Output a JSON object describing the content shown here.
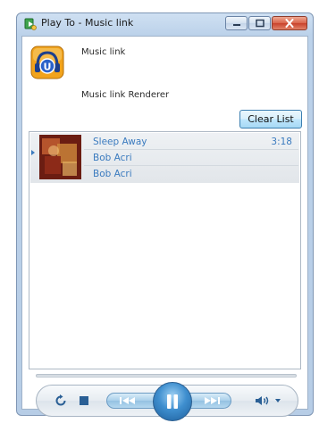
{
  "window": {
    "title": "Play To - Music link",
    "minimize_label": "minimize",
    "maximize_label": "maximize",
    "close_label": "close"
  },
  "device": {
    "name": "Music link",
    "renderer": "Music link Renderer",
    "icon": "music-link-headphones-icon"
  },
  "toolbar": {
    "clear_list_label": "Clear List"
  },
  "playlist": {
    "items": [
      {
        "title": "Sleep Away",
        "duration": "3:18",
        "artist": "Bob Acri",
        "album": "Bob Acri",
        "now_playing": true
      }
    ]
  },
  "transport": {
    "state": "playing",
    "icons": [
      "repeat-icon",
      "stop-icon",
      "previous-icon",
      "pause-icon",
      "next-icon",
      "volume-icon",
      "chevron-down-icon"
    ]
  },
  "colors": {
    "accent": "#3b7bbf",
    "frame": "#b7cde6",
    "close": "#c8412a"
  }
}
